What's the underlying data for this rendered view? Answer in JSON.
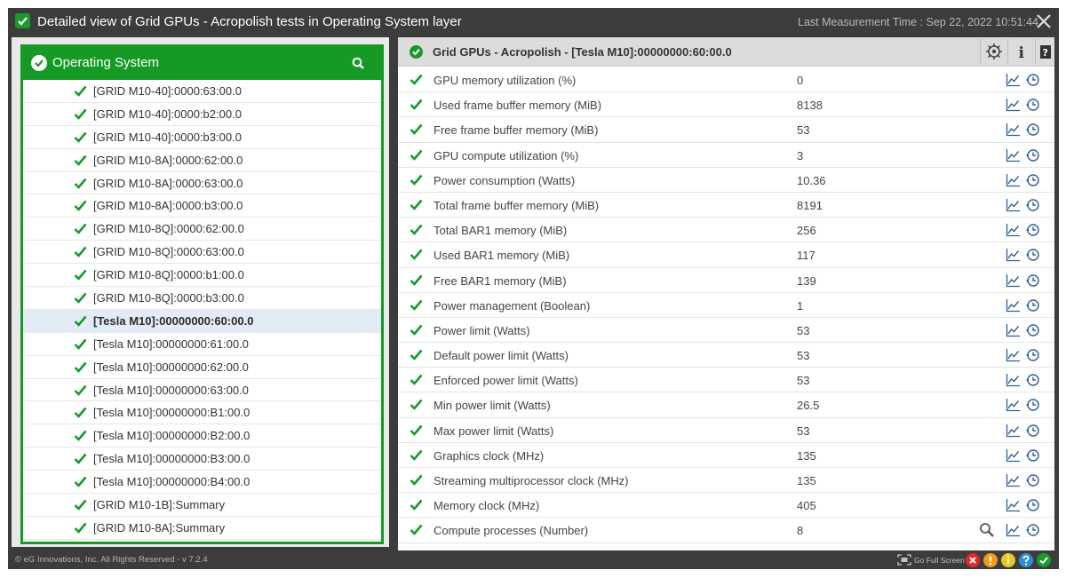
{
  "window": {
    "title": "Detailed view of Grid GPUs - Acropolish tests in Operating System layer",
    "last_measurement": "Last Measurement Time : Sep 22, 2022 10:51:44"
  },
  "left_panel": {
    "title": "Operating System",
    "items": [
      {
        "label": "[GRID M10-40]:0000:63:00.0"
      },
      {
        "label": "[GRID M10-40]:0000:b2:00.0"
      },
      {
        "label": "[GRID M10-40]:0000:b3:00.0"
      },
      {
        "label": "[GRID M10-8A]:0000:62:00.0"
      },
      {
        "label": "[GRID M10-8A]:0000:63:00.0"
      },
      {
        "label": "[GRID M10-8A]:0000:b3:00.0"
      },
      {
        "label": "[GRID M10-8Q]:0000:62:00.0"
      },
      {
        "label": "[GRID M10-8Q]:0000:63:00.0"
      },
      {
        "label": "[GRID M10-8Q]:0000:b1:00.0"
      },
      {
        "label": "[GRID M10-8Q]:0000:b3:00.0"
      },
      {
        "label": "[Tesla M10]:00000000:60:00.0",
        "selected": true
      },
      {
        "label": "[Tesla M10]:00000000:61:00.0"
      },
      {
        "label": "[Tesla M10]:00000000:62:00.0"
      },
      {
        "label": "[Tesla M10]:00000000:63:00.0"
      },
      {
        "label": "[Tesla M10]:00000000:B1:00.0"
      },
      {
        "label": "[Tesla M10]:00000000:B2:00.0"
      },
      {
        "label": "[Tesla M10]:00000000:B3:00.0"
      },
      {
        "label": "[Tesla M10]:00000000:B4:00.0"
      },
      {
        "label": "[GRID M10-1B]:Summary"
      },
      {
        "label": "[GRID M10-8A]:Summary"
      }
    ]
  },
  "right_panel": {
    "title": "Grid GPUs - Acropolish - [Tesla M10]:00000000:60:00.0",
    "header_buttons": [
      "configure-icon",
      "info-icon",
      "help-icon"
    ],
    "metrics": [
      {
        "name": "GPU memory utilization (%)",
        "value": "0"
      },
      {
        "name": "Used frame buffer memory (MiB)",
        "value": "8138"
      },
      {
        "name": "Free frame buffer memory (MiB)",
        "value": "53"
      },
      {
        "name": "GPU compute utilization (%)",
        "value": "3"
      },
      {
        "name": "Power consumption (Watts)",
        "value": "10.36"
      },
      {
        "name": "Total frame buffer memory (MiB)",
        "value": "8191"
      },
      {
        "name": "Total BAR1 memory (MiB)",
        "value": "256"
      },
      {
        "name": "Used BAR1 memory (MiB)",
        "value": "117"
      },
      {
        "name": "Free BAR1 memory (MiB)",
        "value": "139"
      },
      {
        "name": "Power management (Boolean)",
        "value": "1"
      },
      {
        "name": "Power limit (Watts)",
        "value": "53"
      },
      {
        "name": "Default power limit (Watts)",
        "value": "53"
      },
      {
        "name": "Enforced power limit (Watts)",
        "value": "53"
      },
      {
        "name": "Min power limit (Watts)",
        "value": "26.5"
      },
      {
        "name": "Max power limit (Watts)",
        "value": "53"
      },
      {
        "name": "Graphics clock (MHz)",
        "value": "135"
      },
      {
        "name": "Streaming multiprocessor clock (MHz)",
        "value": "135"
      },
      {
        "name": "Memory clock (MHz)",
        "value": "405"
      },
      {
        "name": "Compute processes (Number)",
        "value": "8",
        "detail": true
      }
    ]
  },
  "footer": {
    "copyright": "© eG Innovations, Inc. All Rights Reserved - v 7.2.4",
    "fullscreen_label": "Go Full Screen",
    "status_icons": [
      {
        "name": "critical-icon",
        "color": "#e8262a"
      },
      {
        "name": "major-icon",
        "color": "#f39a1e"
      },
      {
        "name": "minor-icon",
        "color": "#e8c81e"
      },
      {
        "name": "unknown-icon",
        "color": "#2a8fd8"
      },
      {
        "name": "normal-icon",
        "color": "#1a9a2a"
      }
    ]
  },
  "colors": {
    "accent_green": "#159a25",
    "frame_dark": "#3c3c3c",
    "selected_row": "#e3ecf6"
  }
}
